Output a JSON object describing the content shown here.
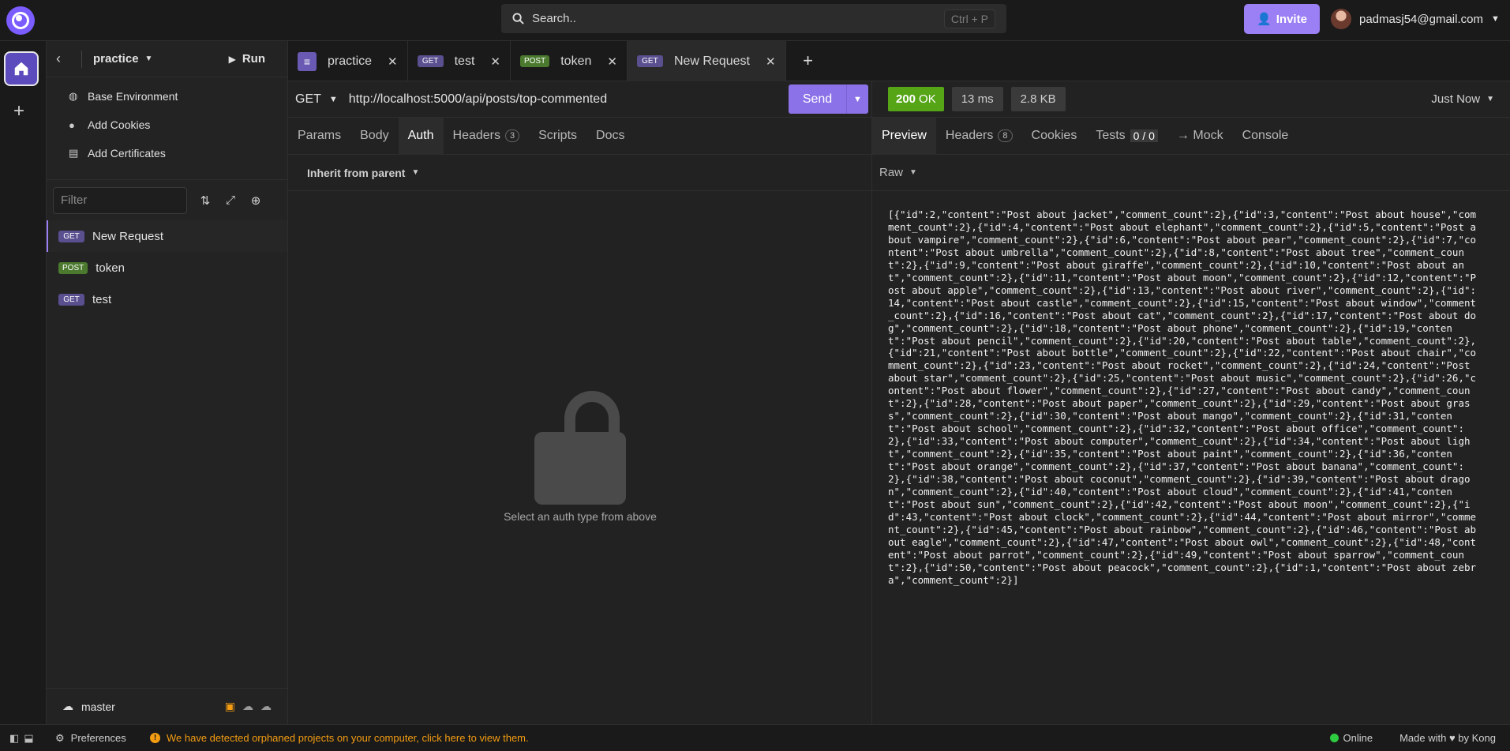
{
  "topbar": {
    "search_placeholder": "Search..",
    "search_shortcut": "Ctrl + P",
    "invite_label": "Invite",
    "user_email": "padmasj54@gmail.com"
  },
  "sidebar": {
    "project": "practice",
    "run_label": "Run",
    "menu": [
      {
        "label": "Base Environment",
        "icon": "globe-icon"
      },
      {
        "label": "Add Cookies",
        "icon": "cookie-icon"
      },
      {
        "label": "Add Certificates",
        "icon": "certificate-icon"
      }
    ],
    "filter_placeholder": "Filter",
    "requests": [
      {
        "method": "GET",
        "name": "New Request",
        "active": true
      },
      {
        "method": "POST",
        "name": "token",
        "active": false
      },
      {
        "method": "GET",
        "name": "test",
        "active": false
      }
    ],
    "branch": "master"
  },
  "tabs": [
    {
      "method": "",
      "label": "practice",
      "icon": "document-icon"
    },
    {
      "method": "GET",
      "label": "test"
    },
    {
      "method": "POST",
      "label": "token"
    },
    {
      "method": "GET",
      "label": "New Request",
      "active": true
    }
  ],
  "request": {
    "method": "GET",
    "url": "http://localhost:5000/api/posts/top-commented",
    "send_label": "Send",
    "subtabs": [
      "Params",
      "Body",
      "Auth",
      "Headers",
      "Scripts",
      "Docs"
    ],
    "active_subtab": "Auth",
    "headers_count": "3",
    "auth_type": "Inherit from parent",
    "auth_hint": "Select an auth type from above"
  },
  "response": {
    "status_code": "200",
    "status_text": "OK",
    "time": "13 ms",
    "size": "2.8 KB",
    "when": "Just Now",
    "tabs": [
      "Preview",
      "Headers",
      "Cookies",
      "Tests",
      "→ Mock",
      "Console"
    ],
    "headers_count": "8",
    "tests_count": "0 / 0",
    "format": "Raw",
    "body": "[{\"id\":2,\"content\":\"Post about jacket\",\"comment_count\":2},{\"id\":3,\"content\":\"Post about house\",\"comment_count\":2},{\"id\":4,\"content\":\"Post about elephant\",\"comment_count\":2},{\"id\":5,\"content\":\"Post about vampire\",\"comment_count\":2},{\"id\":6,\"content\":\"Post about pear\",\"comment_count\":2},{\"id\":7,\"content\":\"Post about umbrella\",\"comment_count\":2},{\"id\":8,\"content\":\"Post about tree\",\"comment_count\":2},{\"id\":9,\"content\":\"Post about giraffe\",\"comment_count\":2},{\"id\":10,\"content\":\"Post about ant\",\"comment_count\":2},{\"id\":11,\"content\":\"Post about moon\",\"comment_count\":2},{\"id\":12,\"content\":\"Post about apple\",\"comment_count\":2},{\"id\":13,\"content\":\"Post about river\",\"comment_count\":2},{\"id\":14,\"content\":\"Post about castle\",\"comment_count\":2},{\"id\":15,\"content\":\"Post about window\",\"comment_count\":2},{\"id\":16,\"content\":\"Post about cat\",\"comment_count\":2},{\"id\":17,\"content\":\"Post about dog\",\"comment_count\":2},{\"id\":18,\"content\":\"Post about phone\",\"comment_count\":2},{\"id\":19,\"content\":\"Post about pencil\",\"comment_count\":2},{\"id\":20,\"content\":\"Post about table\",\"comment_count\":2},{\"id\":21,\"content\":\"Post about bottle\",\"comment_count\":2},{\"id\":22,\"content\":\"Post about chair\",\"comment_count\":2},{\"id\":23,\"content\":\"Post about rocket\",\"comment_count\":2},{\"id\":24,\"content\":\"Post about star\",\"comment_count\":2},{\"id\":25,\"content\":\"Post about music\",\"comment_count\":2},{\"id\":26,\"content\":\"Post about flower\",\"comment_count\":2},{\"id\":27,\"content\":\"Post about candy\",\"comment_count\":2},{\"id\":28,\"content\":\"Post about paper\",\"comment_count\":2},{\"id\":29,\"content\":\"Post about grass\",\"comment_count\":2},{\"id\":30,\"content\":\"Post about mango\",\"comment_count\":2},{\"id\":31,\"content\":\"Post about school\",\"comment_count\":2},{\"id\":32,\"content\":\"Post about office\",\"comment_count\":2},{\"id\":33,\"content\":\"Post about computer\",\"comment_count\":2},{\"id\":34,\"content\":\"Post about light\",\"comment_count\":2},{\"id\":35,\"content\":\"Post about paint\",\"comment_count\":2},{\"id\":36,\"content\":\"Post about orange\",\"comment_count\":2},{\"id\":37,\"content\":\"Post about banana\",\"comment_count\":2},{\"id\":38,\"content\":\"Post about coconut\",\"comment_count\":2},{\"id\":39,\"content\":\"Post about dragon\",\"comment_count\":2},{\"id\":40,\"content\":\"Post about cloud\",\"comment_count\":2},{\"id\":41,\"content\":\"Post about sun\",\"comment_count\":2},{\"id\":42,\"content\":\"Post about moon\",\"comment_count\":2},{\"id\":43,\"content\":\"Post about clock\",\"comment_count\":2},{\"id\":44,\"content\":\"Post about mirror\",\"comment_count\":2},{\"id\":45,\"content\":\"Post about rainbow\",\"comment_count\":2},{\"id\":46,\"content\":\"Post about eagle\",\"comment_count\":2},{\"id\":47,\"content\":\"Post about owl\",\"comment_count\":2},{\"id\":48,\"content\":\"Post about parrot\",\"comment_count\":2},{\"id\":49,\"content\":\"Post about sparrow\",\"comment_count\":2},{\"id\":50,\"content\":\"Post about peacock\",\"comment_count\":2},{\"id\":1,\"content\":\"Post about zebra\",\"comment_count\":2}]"
  },
  "footer": {
    "preferences": "Preferences",
    "warning": "We have detected orphaned projects on your computer, click here to view them.",
    "online": "Online",
    "made_with": "Made with ♥ by Kong"
  }
}
